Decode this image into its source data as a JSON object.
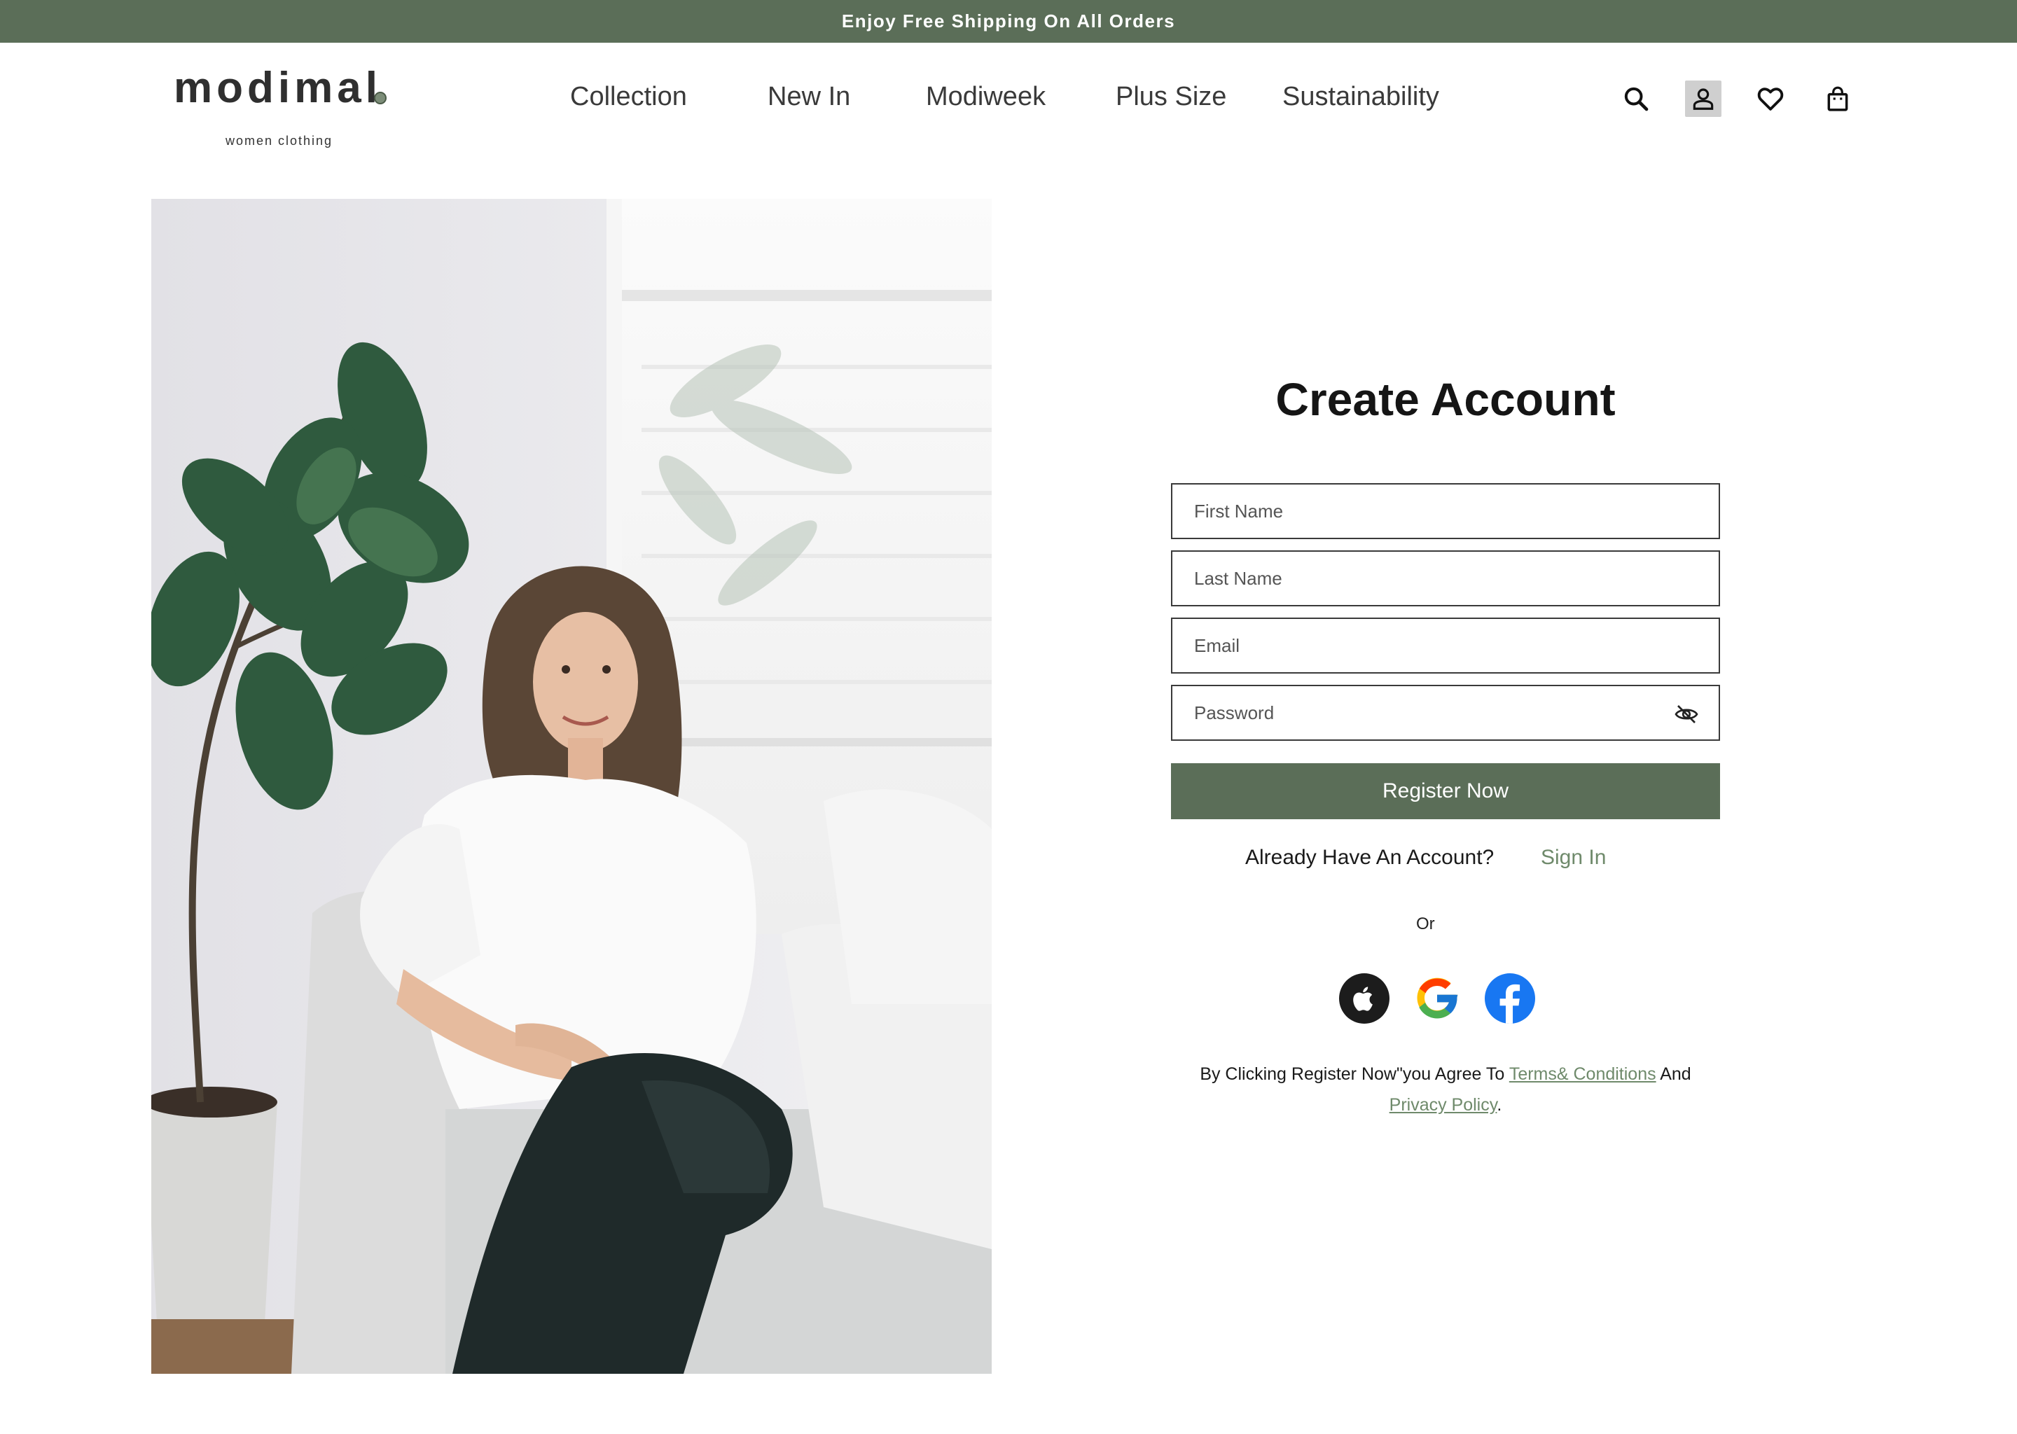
{
  "announcement": {
    "text": "Enjoy Free Shipping On All Orders"
  },
  "brand": {
    "name": "modimal",
    "tagline": "women clothing"
  },
  "nav": {
    "items": [
      {
        "label": "Collection"
      },
      {
        "label": "New In"
      },
      {
        "label": "Modiweek"
      },
      {
        "label": "Plus Size"
      },
      {
        "label": "Sustainability"
      }
    ]
  },
  "header_icons": [
    "search-icon",
    "account-icon",
    "wishlist-heart-icon",
    "shopping-bag-icon"
  ],
  "form": {
    "title": "Create Account",
    "first_name_placeholder": "First Name",
    "last_name_placeholder": "Last Name",
    "email_placeholder": "Email",
    "password_placeholder": "Password",
    "register_label": "Register Now",
    "already_text": "Already Have An Account?",
    "signin_label": "Sign In",
    "or_text": "Or",
    "social": [
      "apple-icon",
      "google-icon",
      "facebook-icon"
    ],
    "terms_prefix": "By Clicking Register Now\"you Agree To ",
    "terms_link": "Terms& Conditions",
    "terms_mid": " And",
    "privacy_link": "Privacy Policy",
    "terms_suffix": "."
  },
  "colors": {
    "brand_green": "#5b6e58",
    "link_green": "#6f8a6b",
    "text": "#1a1a1a"
  }
}
